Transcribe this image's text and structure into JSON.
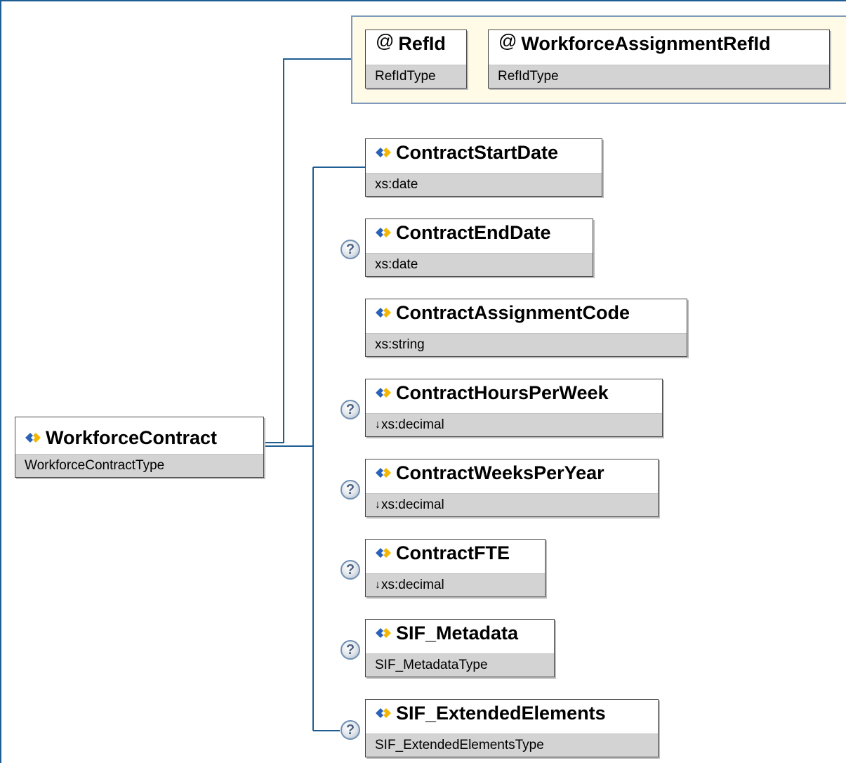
{
  "root": {
    "name": "WorkforceContract",
    "type": "WorkforceContractType",
    "icon": "element-icon"
  },
  "attributes": [
    {
      "name": "RefId",
      "type": "RefIdType",
      "icon": "at-sign-icon"
    },
    {
      "name": "WorkforceAssignmentRefId",
      "type": "RefIdType",
      "icon": "at-sign-icon"
    }
  ],
  "attribute_symbol": "@",
  "optional_symbol": "?",
  "simple_type_marker": "↓",
  "children": [
    {
      "name": "ContractStartDate",
      "type": "xs:date",
      "optional": false,
      "restricted": false
    },
    {
      "name": "ContractEndDate",
      "type": "xs:date",
      "optional": true,
      "restricted": false
    },
    {
      "name": "ContractAssignmentCode",
      "type": "xs:string",
      "optional": false,
      "restricted": false
    },
    {
      "name": "ContractHoursPerWeek",
      "type": "xs:decimal",
      "optional": true,
      "restricted": true
    },
    {
      "name": "ContractWeeksPerYear",
      "type": "xs:decimal",
      "optional": true,
      "restricted": true
    },
    {
      "name": "ContractFTE",
      "type": "xs:decimal",
      "optional": true,
      "restricted": true
    },
    {
      "name": "SIF_Metadata",
      "type": "SIF_MetadataType",
      "optional": true,
      "restricted": false
    },
    {
      "name": "SIF_ExtendedElements",
      "type": "SIF_ExtendedElementsType",
      "optional": true,
      "restricted": false
    }
  ],
  "colors": {
    "frame": "#1f5e93",
    "connector": "#1f5e93",
    "attribute_group_bg": "#fffbe6",
    "attribute_group_border": "#7f99bc",
    "type_band": "#d3d3d3",
    "icon_blue": "#2a62b8",
    "icon_gold": "#f2b705"
  }
}
